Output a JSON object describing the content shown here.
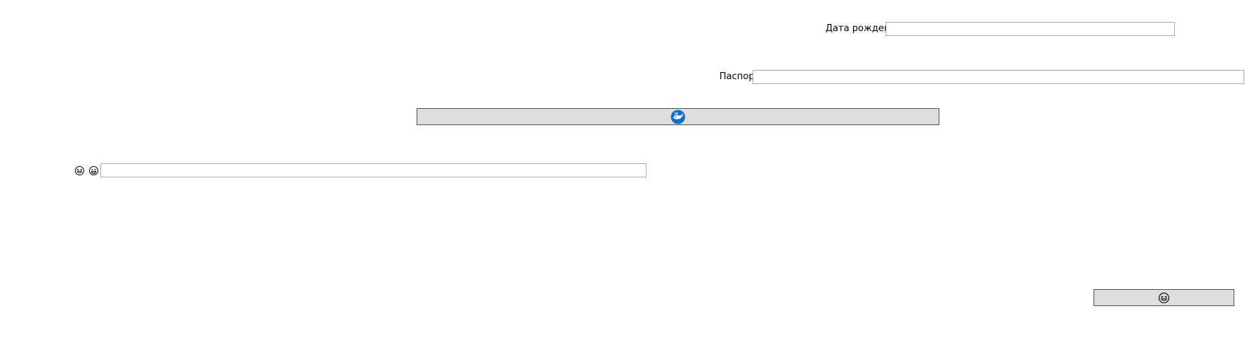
{
  "form": {
    "birth_date": {
      "label": "Дата рождения",
      "value": "",
      "placeholder": ""
    },
    "passport": {
      "label": "Паспорт",
      "value": "",
      "placeholder": ""
    },
    "middle_button": {
      "icon": "blue-whale-icon",
      "icon_color": "#0a6fd1"
    },
    "emoji_row": {
      "icons": [
        "grinning-squint-face-icon",
        "grinning-face-icon"
      ],
      "value": "",
      "placeholder": ""
    },
    "bottom_button": {
      "icon": "grinning-squint-face-icon"
    }
  },
  "colors": {
    "button_bg": "#dedede",
    "button_border": "#505050",
    "field_border": "#a9a9a9",
    "page_bg": "#ffffff"
  }
}
